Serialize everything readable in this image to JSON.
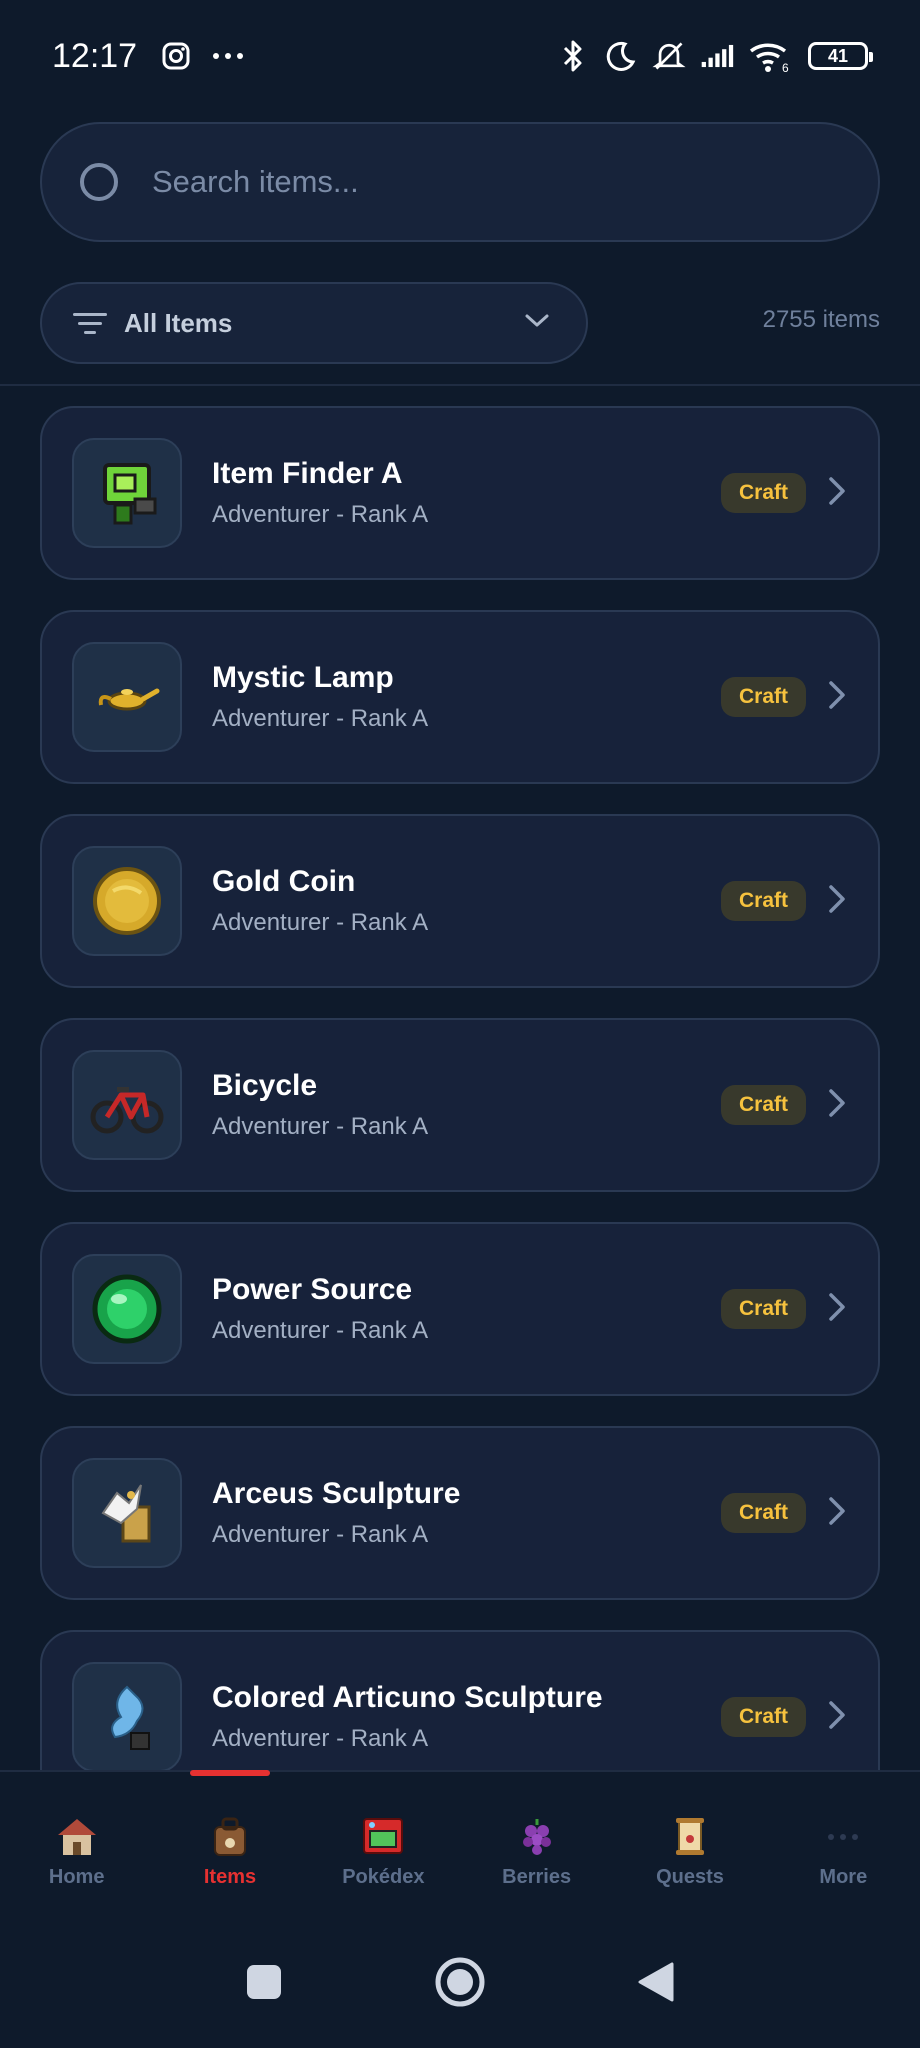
{
  "status_bar": {
    "time": "12:17",
    "battery": "41",
    "network_badge": "6"
  },
  "search": {
    "placeholder": "Search items..."
  },
  "filter": {
    "label": "All Items",
    "count": "2755 items"
  },
  "items": [
    {
      "name": "Item Finder A",
      "subtitle": "Adventurer - Rank A",
      "badge": "Craft",
      "icon": "item-finder-icon"
    },
    {
      "name": "Mystic Lamp",
      "subtitle": "Adventurer - Rank A",
      "badge": "Craft",
      "icon": "lamp-icon"
    },
    {
      "name": "Gold Coin",
      "subtitle": "Adventurer - Rank A",
      "badge": "Craft",
      "icon": "coin-icon"
    },
    {
      "name": "Bicycle",
      "subtitle": "Adventurer - Rank A",
      "badge": "Craft",
      "icon": "bicycle-icon"
    },
    {
      "name": "Power Source",
      "subtitle": "Adventurer - Rank A",
      "badge": "Craft",
      "icon": "orb-icon"
    },
    {
      "name": "Arceus Sculpture",
      "subtitle": "Adventurer - Rank A",
      "badge": "Craft",
      "icon": "sculpture-icon"
    },
    {
      "name": "Colored Articuno Sculpture",
      "subtitle": "Adventurer - Rank A",
      "badge": "Craft",
      "icon": "bird-sculpture-icon"
    }
  ],
  "bottom_nav": {
    "items": [
      {
        "label": "Home",
        "icon": "house-icon",
        "active": false
      },
      {
        "label": "Items",
        "icon": "bag-icon",
        "active": true
      },
      {
        "label": "Pokédex",
        "icon": "pokedex-icon",
        "active": false
      },
      {
        "label": "Berries",
        "icon": "berry-icon",
        "active": false
      },
      {
        "label": "Quests",
        "icon": "scroll-icon",
        "active": false
      },
      {
        "label": "More",
        "icon": "more-icon",
        "active": false
      }
    ]
  },
  "colors": {
    "background": "#0e1a2b",
    "card": "#17223a",
    "accent_red": "#e63131",
    "badge_text": "#f6c23e",
    "badge_bg": "#38392c"
  }
}
